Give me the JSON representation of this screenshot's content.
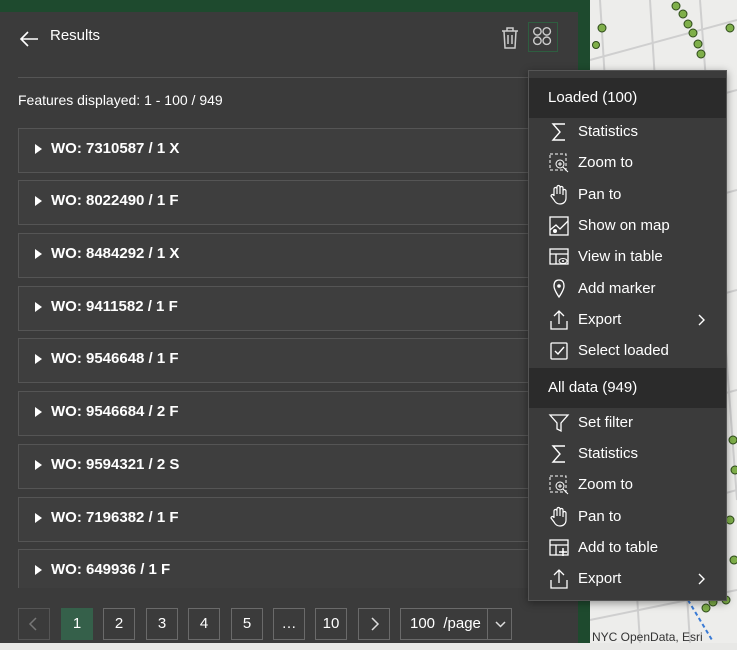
{
  "panel": {
    "title": "Results",
    "features_displayed": "Features displayed: 1 - 100 / 949"
  },
  "results": [
    {
      "label": "WO: 7310587 / 1 X"
    },
    {
      "label": "WO: 8022490 / 1 F"
    },
    {
      "label": "WO: 8484292 / 1 X"
    },
    {
      "label": "WO: 9411582 / 1 F"
    },
    {
      "label": "WO: 9546648 / 1 F"
    },
    {
      "label": "WO: 9546684 / 2 F"
    },
    {
      "label": "WO: 9594321 / 2 S"
    },
    {
      "label": "WO: 7196382 / 1 F"
    },
    {
      "label": "WO: 649936 / 1 F"
    }
  ],
  "pagination": {
    "pages": [
      "1",
      "2",
      "3",
      "4",
      "5",
      "…",
      "10"
    ],
    "current": "1",
    "per_page": "100  /page"
  },
  "menu": {
    "loaded_header": "Loaded (100)",
    "loaded_items": [
      {
        "label": "Statistics",
        "icon": "sigma-icon"
      },
      {
        "label": "Zoom to",
        "icon": "zoom-to-icon"
      },
      {
        "label": "Pan to",
        "icon": "hand-icon"
      },
      {
        "label": "Show on map",
        "icon": "map-icon"
      },
      {
        "label": "View in table",
        "icon": "table-view-icon"
      },
      {
        "label": "Add marker",
        "icon": "marker-icon"
      },
      {
        "label": "Export",
        "icon": "export-icon"
      },
      {
        "label": "Select loaded",
        "icon": "checkbox-icon"
      }
    ],
    "all_header": "All data (949)",
    "all_items": [
      {
        "label": "Set filter",
        "icon": "filter-icon"
      },
      {
        "label": "Statistics",
        "icon": "sigma-icon"
      },
      {
        "label": "Zoom to",
        "icon": "zoom-to-icon"
      },
      {
        "label": "Pan to",
        "icon": "hand-icon"
      },
      {
        "label": "Add to table",
        "icon": "add-table-icon"
      },
      {
        "label": "Export",
        "icon": "export-icon"
      }
    ]
  },
  "map": {
    "attribution": "NYC OpenData, Esri"
  },
  "colors": {
    "panel_bg": "#3b3b3b",
    "accent": "#35604a",
    "frame": "#1e4a2e",
    "map_point": "#8bc34a"
  }
}
